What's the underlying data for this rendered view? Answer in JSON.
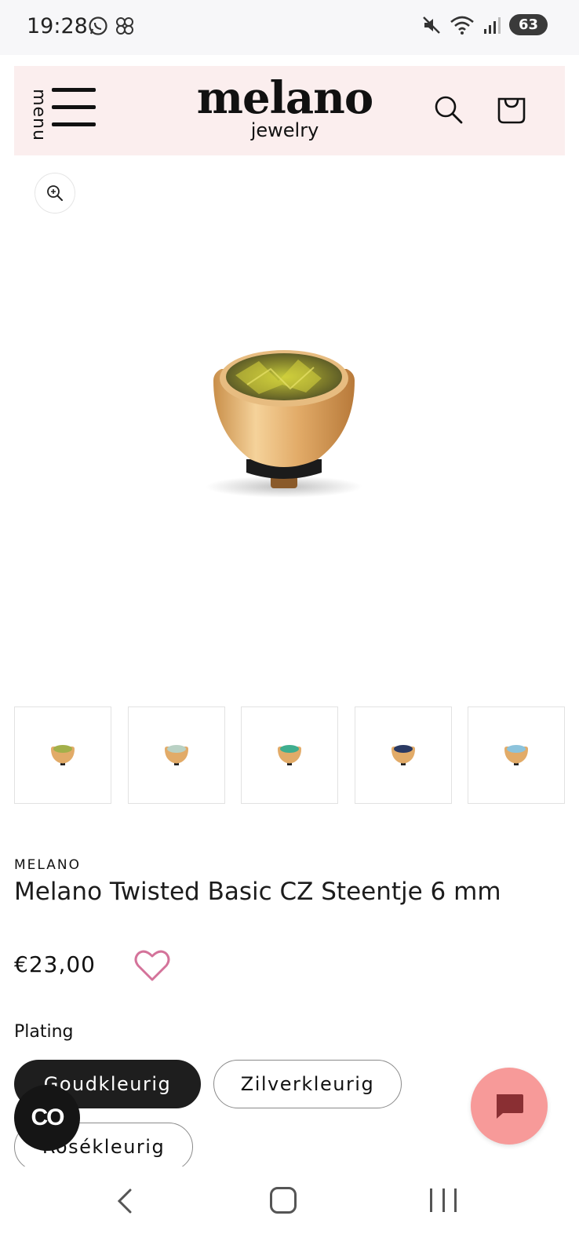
{
  "status_bar": {
    "time": "19:28",
    "battery": "63",
    "left_icons": [
      "whatsapp-icon",
      "pinwheel-icon"
    ],
    "right_icons": [
      "mute-icon",
      "wifi-icon",
      "signal-icon"
    ]
  },
  "header": {
    "menu_label": "menu",
    "brand_name": "melano",
    "brand_sub": "jewelry"
  },
  "product": {
    "vendor": "MELANO",
    "title": "Melano Twisted Basic CZ Steentje 6 mm",
    "price": "€23,00",
    "thumbnail_stone_colors": [
      "#a3b04a",
      "#b9d1c4",
      "#3fae8f",
      "#2b3a63",
      "#8cc3dc"
    ]
  },
  "plating": {
    "label": "Plating",
    "options": [
      "Goudkleurig",
      "Zilverkleurig",
      "Rosékleurig"
    ],
    "selected": "Goudkleurig"
  },
  "floating": {
    "co_label": "CO"
  },
  "colors": {
    "header_bg": "#fbeeee",
    "selected_pill": "#1e1e1e",
    "wishlist": "#d4739a",
    "chat_button": "#f79a99",
    "chat_icon": "#8a2f33"
  }
}
